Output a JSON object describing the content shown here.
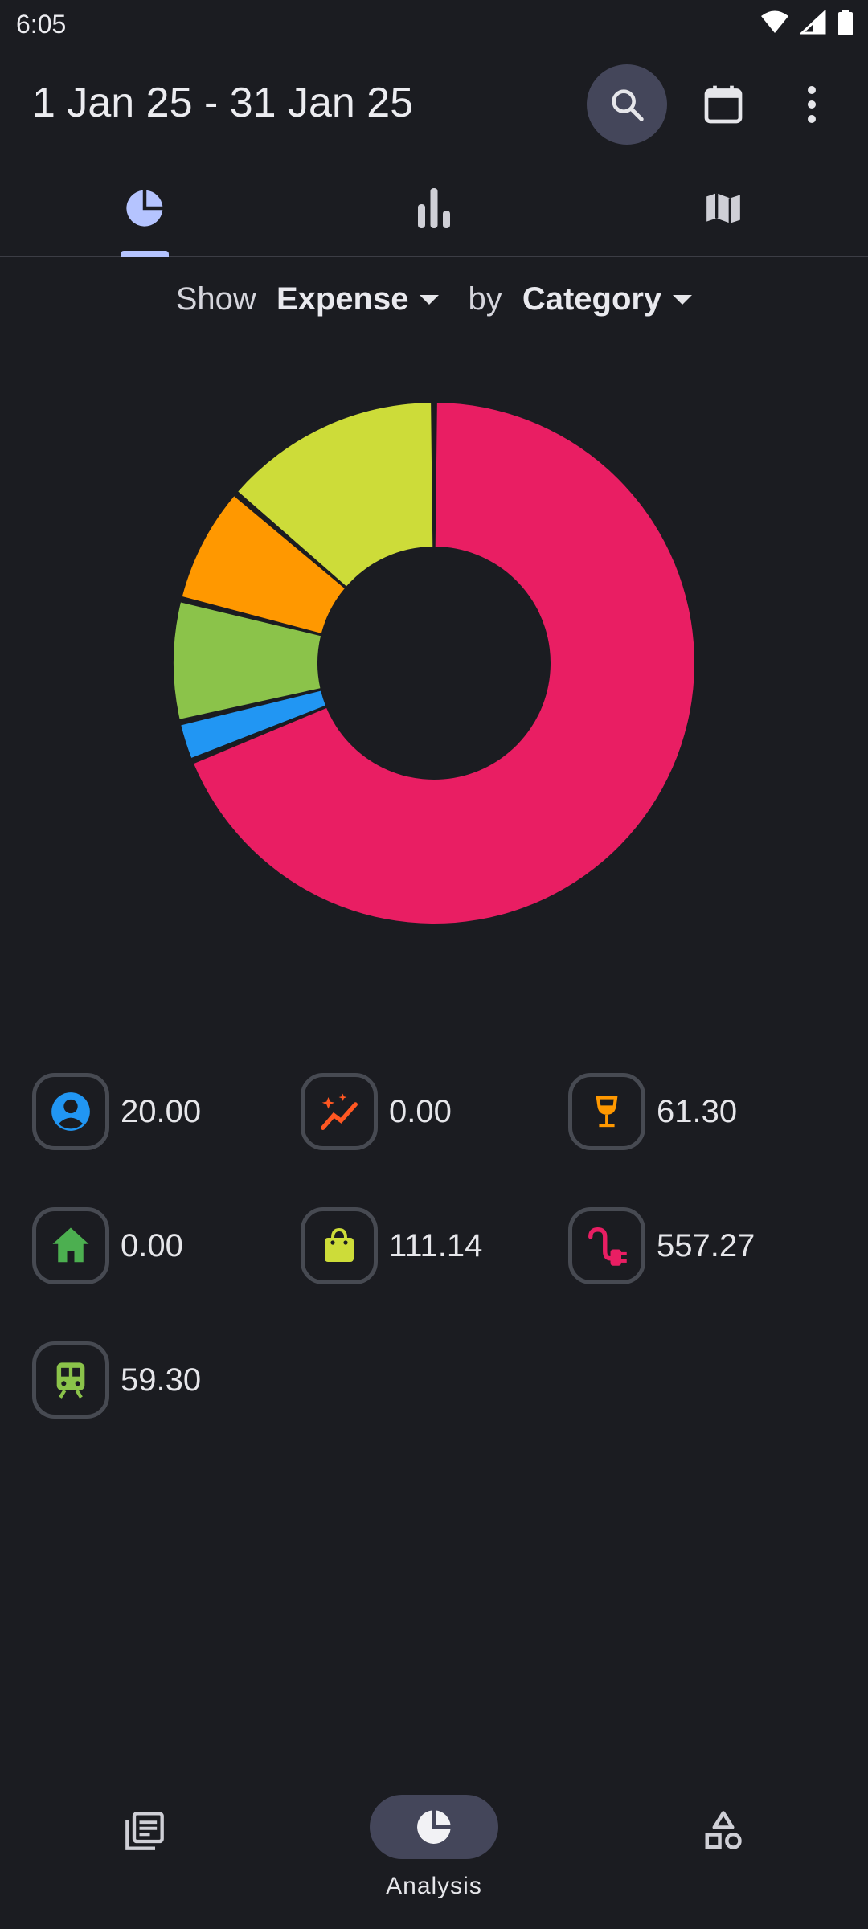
{
  "status": {
    "time": "6:05"
  },
  "appbar": {
    "title": "1 Jan 25 - 31 Jan 25"
  },
  "filter": {
    "show_label": "Show",
    "type_value": "Expense",
    "by_label": "by",
    "group_value": "Category"
  },
  "chart_data": {
    "type": "pie",
    "donut": true,
    "slices": [
      {
        "category": "misc",
        "value": 20.0,
        "color": "#2196f3"
      },
      {
        "category": "food-and-drink",
        "value": 61.3,
        "color": "#8bc34a"
      },
      {
        "category": "shopping",
        "value": 59.3,
        "color": "#ff9800"
      },
      {
        "category": "transport",
        "value": 111.14,
        "color": "#cddc39"
      },
      {
        "category": "utilities",
        "value": 557.27,
        "color": "#e91e63"
      }
    ]
  },
  "legend": [
    {
      "icon": "person-icon",
      "value": "20.00",
      "color": "#2196f3"
    },
    {
      "icon": "trending-icon",
      "value": "0.00",
      "color": "#ff5722"
    },
    {
      "icon": "wine-icon",
      "value": "61.30",
      "color": "#ff9800"
    },
    {
      "icon": "home-icon",
      "value": "0.00",
      "color": "#4caf50"
    },
    {
      "icon": "bag-icon",
      "value": "111.14",
      "color": "#cddc39"
    },
    {
      "icon": "plug-icon",
      "value": "557.27",
      "color": "#e91e63"
    },
    {
      "icon": "train-icon",
      "value": "59.30",
      "color": "#8bc34a"
    }
  ],
  "nav": {
    "analysis_label": "Analysis"
  },
  "colors": {
    "background": "#1b1c21",
    "accent": "#b5c4ff",
    "pill": "#44465a"
  }
}
